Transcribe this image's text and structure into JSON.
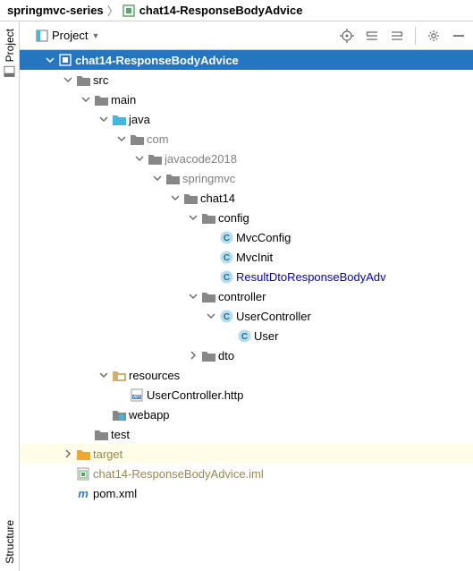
{
  "breadcrumb": {
    "root": "springmvc-series",
    "module": "chat14-ResponseBodyAdvice"
  },
  "sideTabs": {
    "project": "Project",
    "structure": "Structure"
  },
  "toolHeader": {
    "title": "Project"
  },
  "tree": {
    "root": "chat14-ResponseBodyAdvice",
    "src": "src",
    "main": "main",
    "java": "java",
    "com": "com",
    "javacode2018": "javacode2018",
    "springmvc": "springmvc",
    "chat14": "chat14",
    "config": "config",
    "mvcConfig": "MvcConfig",
    "mvcInit": "MvcInit",
    "resultAdvice": "ResultDtoResponseBodyAdv",
    "controller": "controller",
    "userController": "UserController",
    "user": "User",
    "dto": "dto",
    "resources": "resources",
    "httpFile": "UserController.http",
    "webapp": "webapp",
    "test": "test",
    "target": "target",
    "iml": "chat14-ResponseBodyAdvice.iml",
    "pom": "pom.xml"
  }
}
